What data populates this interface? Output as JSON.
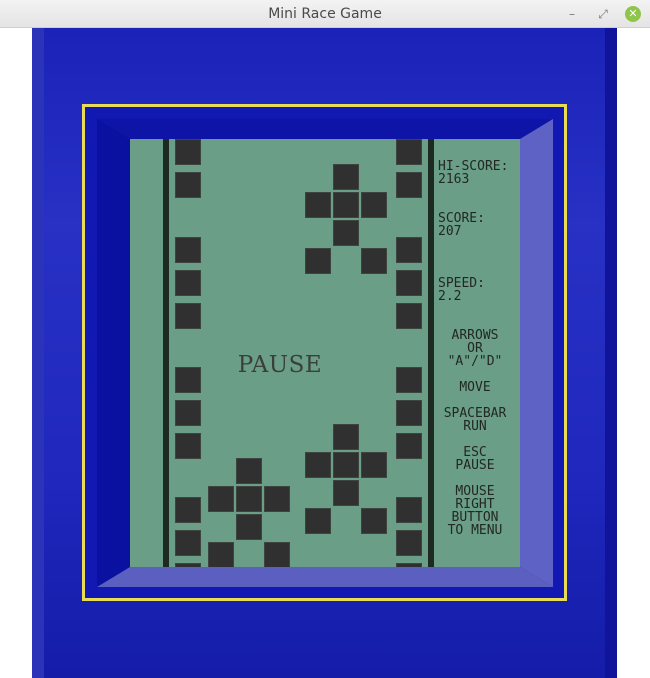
{
  "window": {
    "title": "Mini Race Game",
    "minimize_glyph": "–",
    "restore_glyph": "⤢",
    "close_glyph": "✕"
  },
  "game": {
    "pause_label": "PAUSE",
    "hi_score_label": "HI-SCORE:",
    "hi_score": "2163",
    "score_label": "SCORE:",
    "score": "207",
    "speed_label": "SPEED:",
    "speed": "2.2",
    "help": {
      "arrows_1": "ARROWS",
      "arrows_2": "OR",
      "arrows_3": "\"A\"/\"D\"",
      "move": "MOVE",
      "space": "SPACEBAR",
      "run": "RUN",
      "esc": "ESC",
      "pause": "PAUSE",
      "mouse_1": "MOUSE",
      "mouse_2": "RIGHT",
      "mouse_3": "BUTTON",
      "mouse_4": "TO MENU"
    }
  },
  "colors": {
    "lcd": "#6b9e86",
    "pixel": "#303030",
    "frame_blue": "#1a22b8",
    "frame_accent": "#e8dc55"
  }
}
